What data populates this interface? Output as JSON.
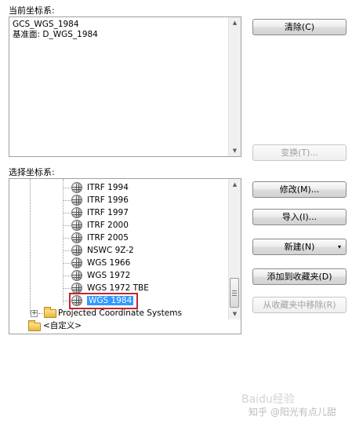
{
  "current_cs": {
    "label": "当前坐标系:",
    "line1": "GCS_WGS_1984",
    "line2": "基准面: D_WGS_1984"
  },
  "buttons": {
    "clear": "清除(C)",
    "transform": "变换(T)...",
    "modify": "修改(M)...",
    "import": "导入(I)...",
    "new": "新建(N)",
    "new_arrow": "▾",
    "add_fav": "添加到收藏夹(D)",
    "remove_fav": "从收藏夹中移除(R)"
  },
  "select_cs": {
    "label": "选择坐标系:",
    "items": [
      "ITRF 1994",
      "ITRF 1996",
      "ITRF 1997",
      "ITRF 2000",
      "ITRF 2005",
      "NSWC 9Z-2",
      "WGS 1966",
      "WGS 1972",
      "WGS 1972 TBE",
      "WGS 1984"
    ],
    "selected": "WGS 1984",
    "projected": "Projected Coordinate Systems",
    "custom": "<自定义>"
  },
  "watermark": {
    "text1": "知乎 @阳光有点儿甜",
    "text2": "Baidu经验"
  }
}
